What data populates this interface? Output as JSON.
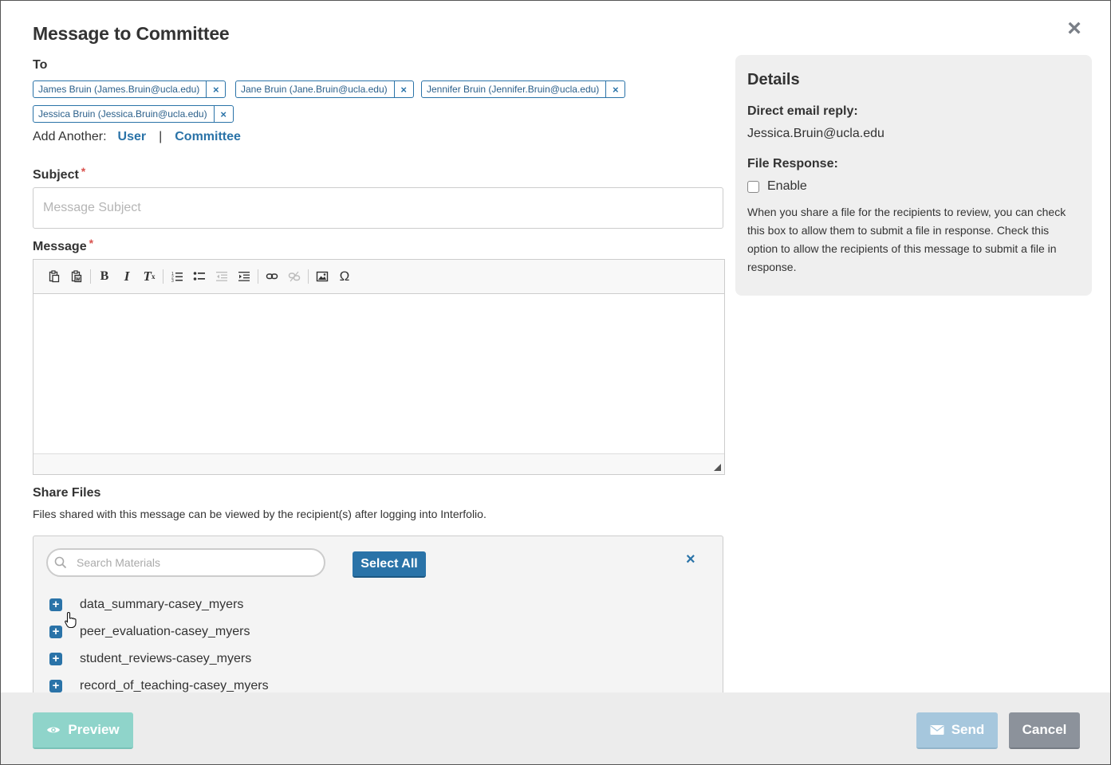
{
  "modal": {
    "title": "Message to Committee",
    "close_icon": "close-icon"
  },
  "to": {
    "label": "To",
    "recipients": [
      {
        "text": "James Bruin (James.Bruin@ucla.edu)"
      },
      {
        "text": "Jane Bruin (Jane.Bruin@ucla.edu)"
      },
      {
        "text": "Jennifer Bruin (Jennifer.Bruin@ucla.edu)"
      },
      {
        "text": "Jessica Bruin (Jessica.Bruin@ucla.edu)"
      }
    ],
    "remove_symbol": "×",
    "add_another_label": "Add Another:",
    "add_user": "User",
    "separator": "|",
    "add_committee": "Committee"
  },
  "subject": {
    "label": "Subject",
    "required_mark": "*",
    "placeholder": "Message Subject",
    "value": ""
  },
  "message": {
    "label": "Message",
    "required_mark": "*",
    "toolbar": [
      "paste",
      "paste-from-word",
      "bold",
      "italic",
      "remove-format",
      "numbered-list",
      "bulleted-list",
      "outdent",
      "indent",
      "link",
      "unlink",
      "image",
      "special-character"
    ]
  },
  "share_files": {
    "title": "Share Files",
    "description": "Files shared with this message can be viewed by the recipient(s) after logging into Interfolio.",
    "search_placeholder": "Search Materials",
    "select_all": "Select All",
    "close_symbol": "×",
    "items": [
      {
        "name": "data_summary-casey_myers"
      },
      {
        "name": "peer_evaluation-casey_myers"
      },
      {
        "name": "student_reviews-casey_myers"
      },
      {
        "name": "record_of_teaching-casey_myers"
      }
    ]
  },
  "details": {
    "title": "Details",
    "reply_label": "Direct email reply:",
    "reply_value": "Jessica.Bruin@ucla.edu",
    "file_response_label": "File Response:",
    "enable_label": "Enable",
    "help_text": "When you share a file for the recipients to review, you can check this box to allow them to submit a file in response. Check this option to allow the recipients of this message to submit a file in response."
  },
  "footer": {
    "preview": "Preview",
    "send": "Send",
    "cancel": "Cancel"
  },
  "colors": {
    "accent": "#2a73a8",
    "preview_button": "#8fd4ca",
    "send_button": "#a6c7dd",
    "cancel_button": "#8c929b",
    "required": "#d9534f"
  }
}
